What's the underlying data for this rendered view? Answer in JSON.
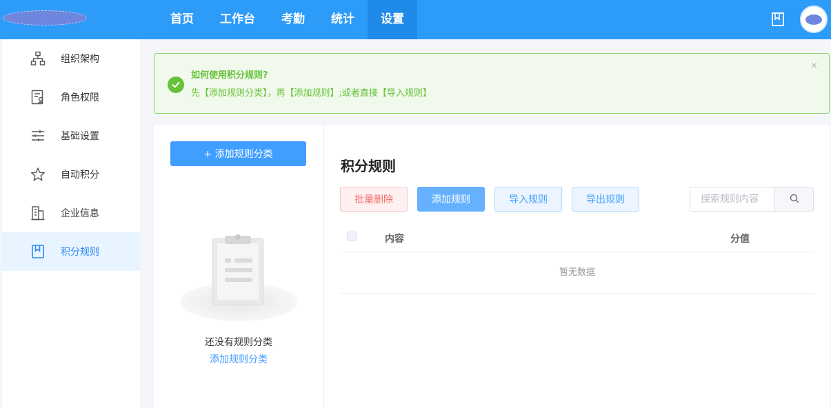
{
  "header": {
    "nav": [
      {
        "label": "首页",
        "active": false
      },
      {
        "label": "工作台",
        "active": false
      },
      {
        "label": "考勤",
        "active": false
      },
      {
        "label": "统计",
        "active": false
      },
      {
        "label": "设置",
        "active": true
      }
    ],
    "icons": {
      "book": "book-icon",
      "avatar": "avatar"
    }
  },
  "sidebar": {
    "items": [
      {
        "label": "组织架构",
        "icon": "org-chart-icon"
      },
      {
        "label": "角色权限",
        "icon": "role-permission-icon"
      },
      {
        "label": "基础设置",
        "icon": "sliders-icon"
      },
      {
        "label": "自动积分",
        "icon": "star-icon"
      },
      {
        "label": "企业信息",
        "icon": "building-icon"
      },
      {
        "label": "积分规则",
        "icon": "bookmark-icon",
        "active": true
      }
    ]
  },
  "alert": {
    "title": "如何使用积分规则?",
    "description": "先【添加规则分类】，再【添加规则】;或者直接【导入规则】",
    "close": "×"
  },
  "category_panel": {
    "add_button": "+ 添加规则分类",
    "empty_text": "还没有规则分类",
    "empty_link": "添加规则分类"
  },
  "rules_panel": {
    "title": "积分规则",
    "buttons": {
      "batch_delete": "批量删除",
      "add_rule": "添加规则",
      "import_rule": "导入规则",
      "export_rule": "导出规则"
    },
    "search": {
      "placeholder": "搜索规则内容",
      "value": ""
    },
    "table": {
      "columns": [
        "内容",
        "分值"
      ],
      "rows": [],
      "empty_text": "暂无数据"
    }
  },
  "colors": {
    "primary": "#2d9bf8",
    "accent": "#409eff",
    "success": "#67c23a",
    "danger": "#f56c6c"
  }
}
